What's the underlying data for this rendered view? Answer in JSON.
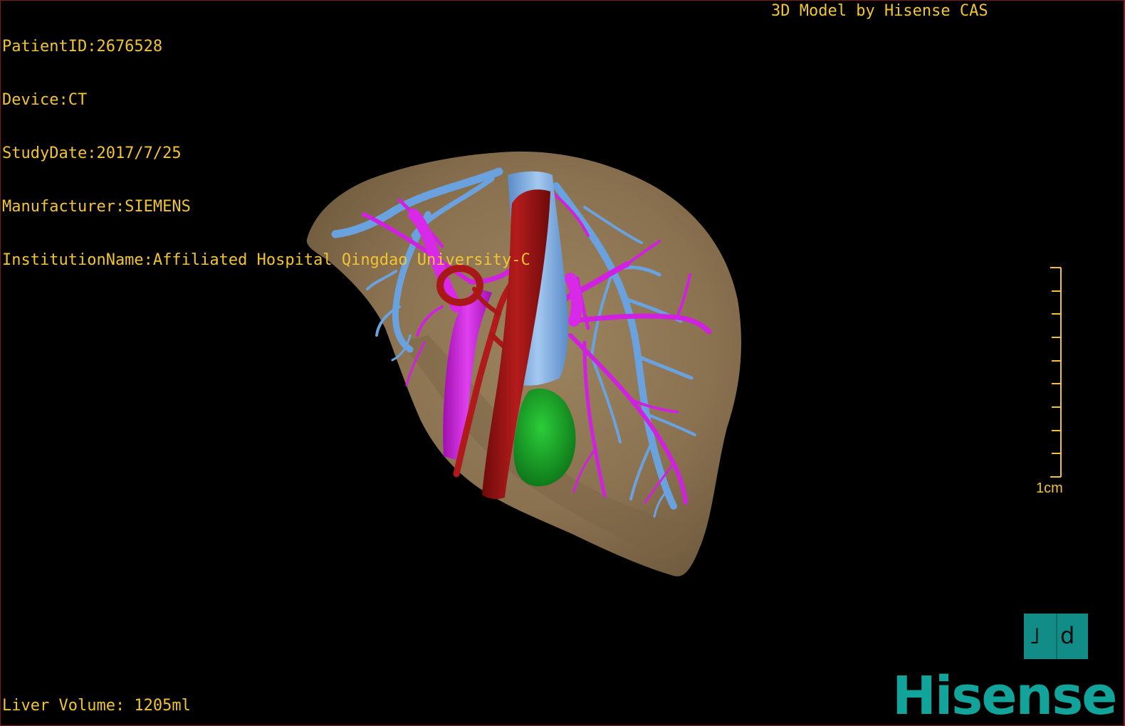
{
  "overlay": {
    "patient_id": "PatientID:2676528",
    "device": "Device:CT",
    "study_date": "StudyDate:2017/7/25",
    "manufacturer": "Manufacturer:SIEMENS",
    "institution": "InstitutionName:Affiliated Hospital Qingdao University-C",
    "model_credit": "3D Model by Hisense CAS",
    "liver_volume": "Liver Volume: 1205ml"
  },
  "scale_bar": {
    "label": "1cm"
  },
  "orientation_cube": {
    "left_face": "˩",
    "right_face": "d"
  },
  "brand": {
    "logo_text": "Hisense"
  },
  "colors": {
    "overlay_text": "#f2c433",
    "liver": "#8b7350",
    "portal_vein": "#d020e0",
    "hepatic_vein": "#6aa2e0",
    "ivc": "#7fb0e8",
    "aorta_artery": "#9e1414",
    "tumor": "#18a028",
    "brand": "#12a39a"
  }
}
